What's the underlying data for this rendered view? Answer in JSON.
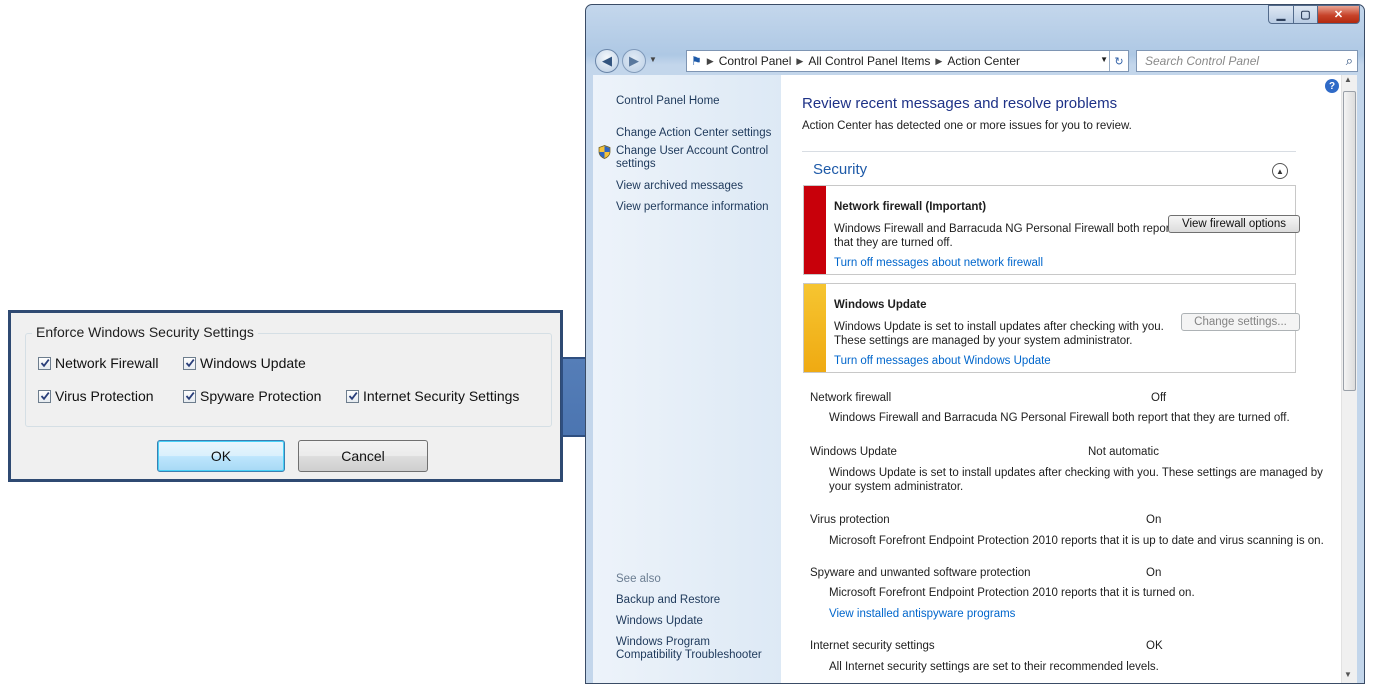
{
  "dialog": {
    "group_title": "Enforce Windows Security Settings",
    "checkboxes": [
      {
        "label": "Network Firewall",
        "checked": true
      },
      {
        "label": "Windows Update",
        "checked": true
      },
      {
        "label": "Virus Protection",
        "checked": true
      },
      {
        "label": "Spyware Protection",
        "checked": true
      },
      {
        "label": "Internet Security Settings",
        "checked": true
      }
    ],
    "ok_label": "OK",
    "cancel_label": "Cancel"
  },
  "window": {
    "breadcrumb": [
      "Control Panel",
      "All Control Panel Items",
      "Action Center"
    ],
    "search_placeholder": "Search Control Panel",
    "sidebar": {
      "home": "Control Panel Home",
      "links": [
        "Change Action Center settings",
        "Change User Account Control settings",
        "View archived messages",
        "View performance information"
      ],
      "see_also_title": "See also",
      "see_also": [
        "Backup and Restore",
        "Windows Update",
        "Windows Program Compatibility Troubleshooter"
      ]
    },
    "main": {
      "title": "Review recent messages and resolve problems",
      "subtitle": "Action Center has detected one or more issues for you to review.",
      "section": "Security",
      "alerts": [
        {
          "title": "Network firewall (Important)",
          "text_1": "Windows Firewall and Barracuda NG Personal Firewall both report",
          "text_2": "that they are turned off.",
          "button": "View firewall options",
          "link": "Turn off messages about network firewall",
          "color": "#c8000a"
        },
        {
          "title": "Windows Update",
          "text_1": "Windows Update is set to install updates after checking with you.",
          "text_2": "These settings are managed by your system administrator.",
          "button": "Change settings...",
          "link": "Turn off messages about Windows Update",
          "color": "#f2b51c"
        }
      ],
      "items": [
        {
          "name": "Network firewall",
          "status": "Off",
          "desc": "Windows Firewall and Barracuda NG Personal Firewall both report that they are turned off."
        },
        {
          "name": "Windows Update",
          "status": "Not automatic",
          "desc": "Windows Update is set to install updates after checking with you.  These settings are managed by",
          "desc_2": "your system administrator."
        },
        {
          "name": "Virus protection",
          "status": "On",
          "desc": "Microsoft Forefront Endpoint Protection 2010 reports that it is up to date and virus scanning is on."
        },
        {
          "name": "Spyware and unwanted software protection",
          "status": "On",
          "desc": "Microsoft Forefront Endpoint Protection 2010 reports that it is turned on.",
          "link": "View installed antispyware programs"
        },
        {
          "name": "Internet security settings",
          "status": "OK",
          "desc": "All Internet security settings are set to their recommended levels."
        }
      ]
    }
  }
}
